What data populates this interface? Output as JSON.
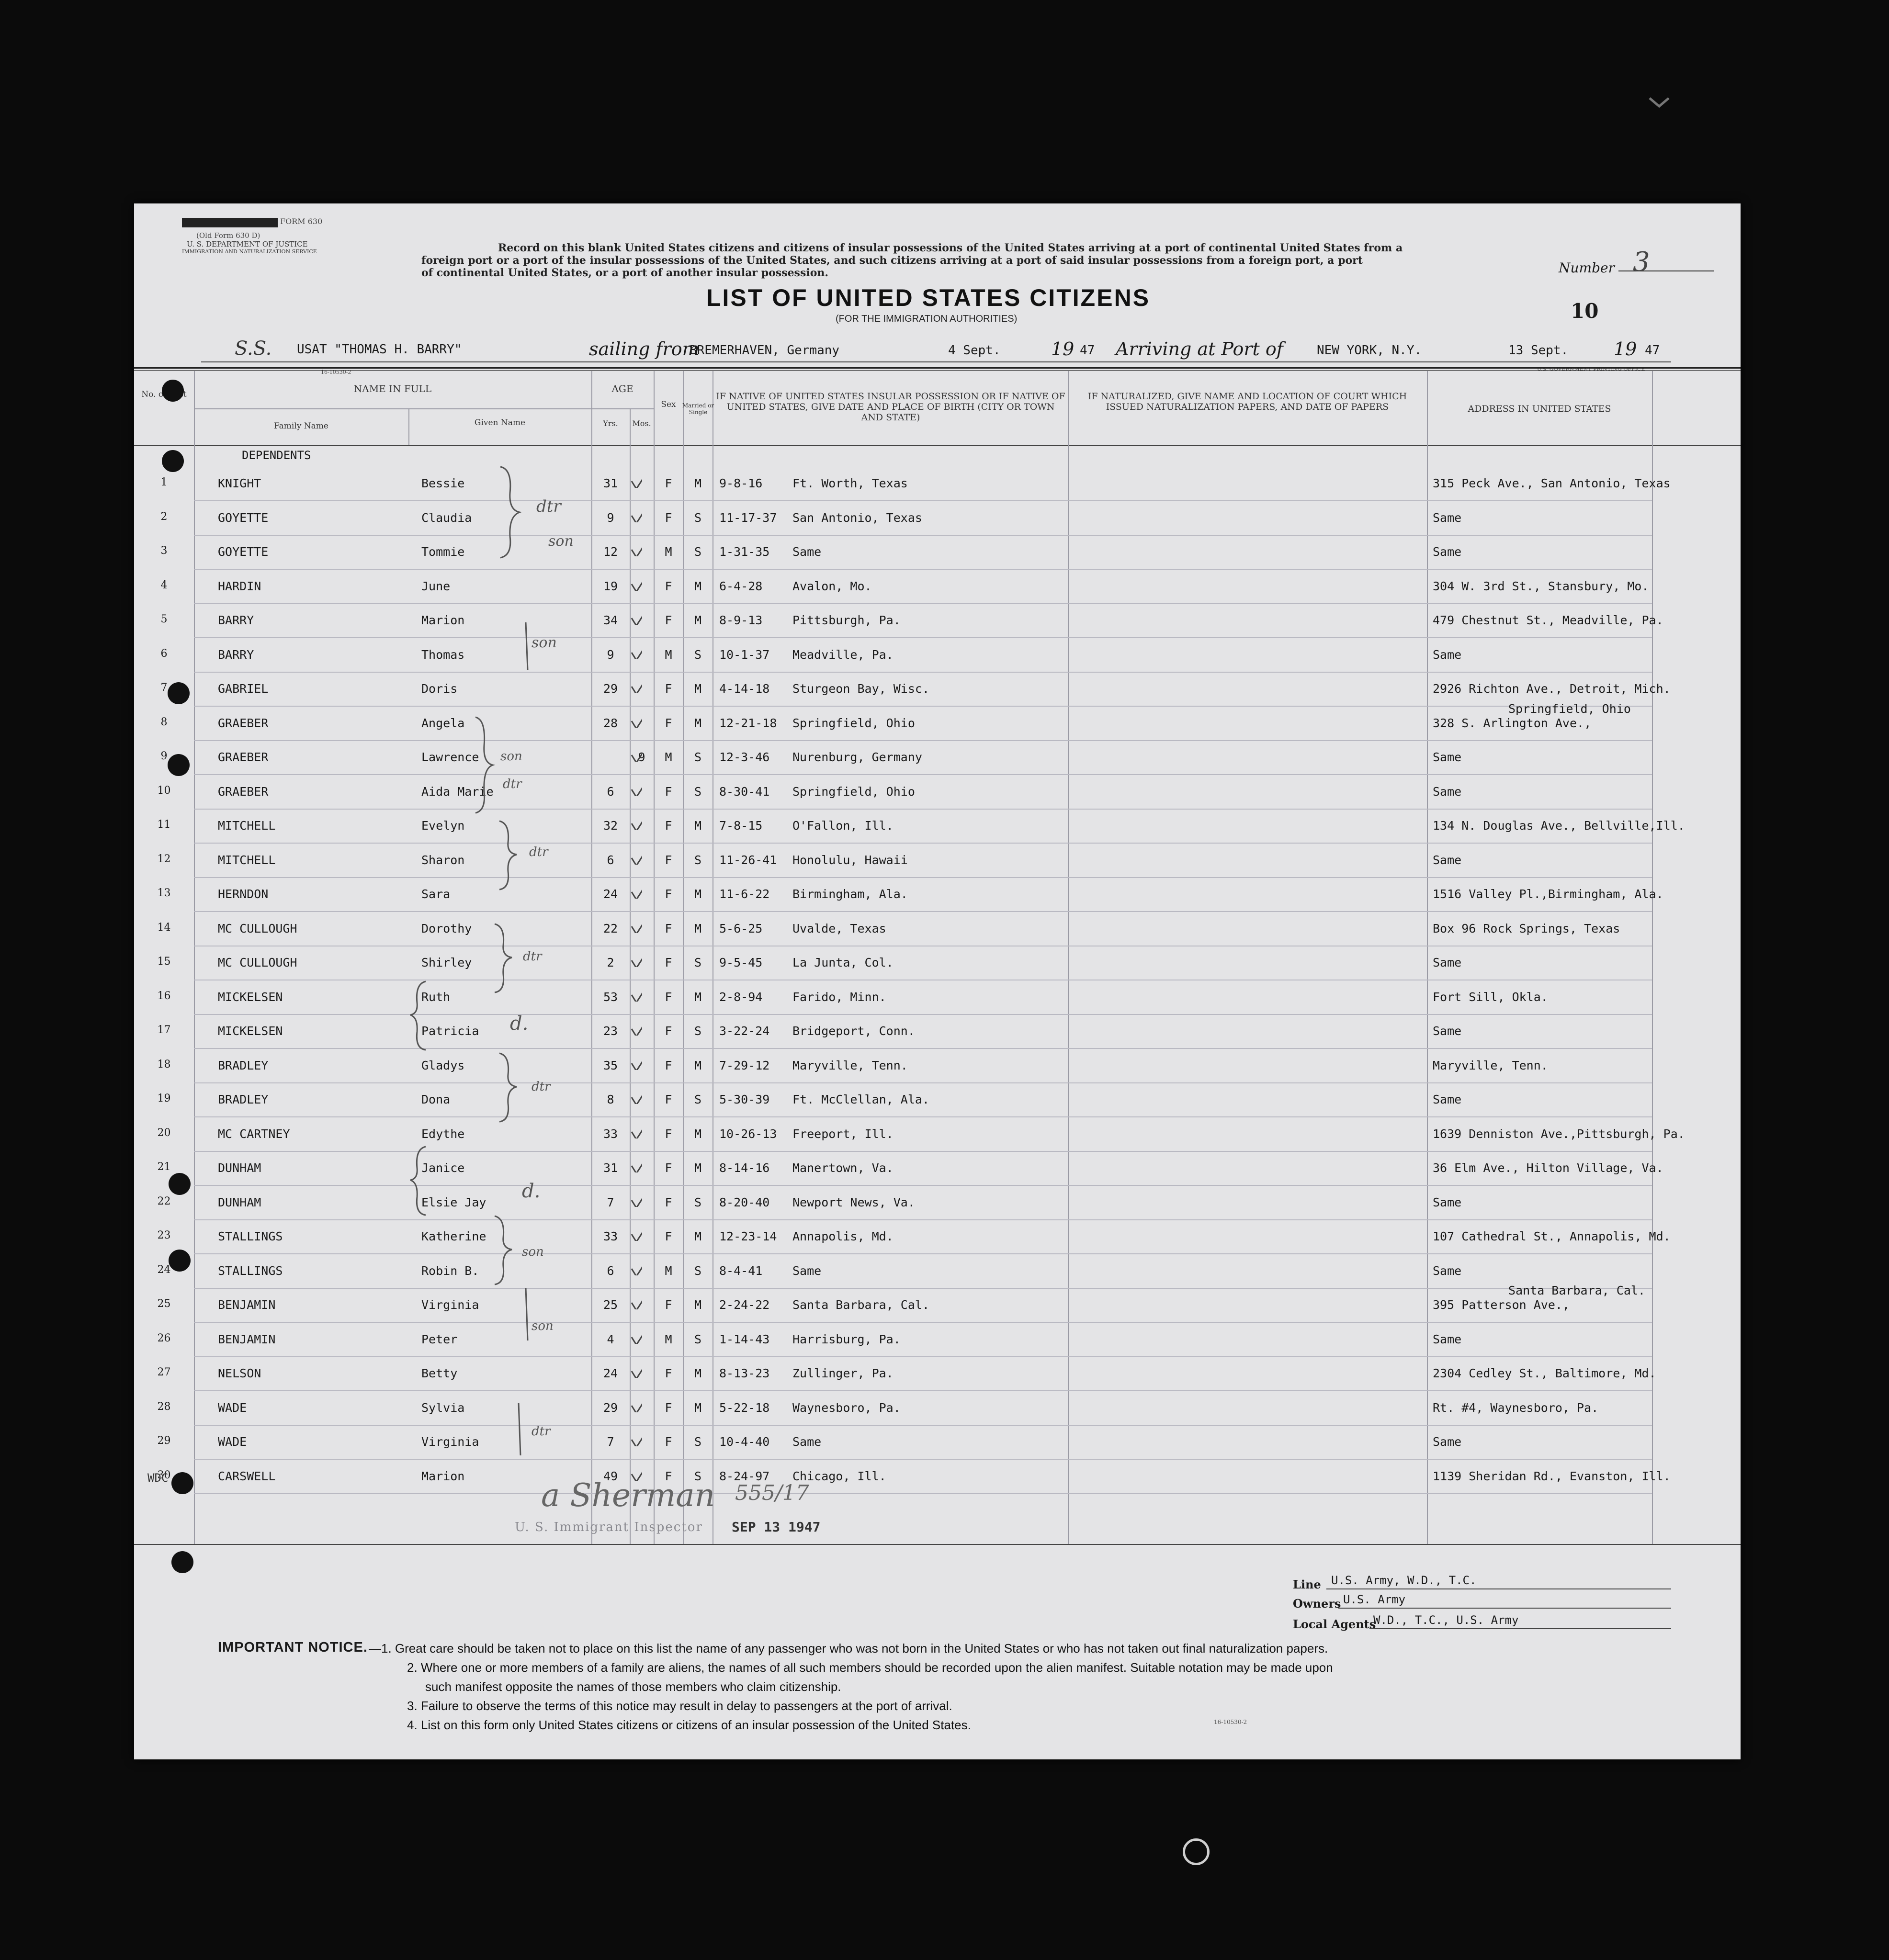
{
  "form": {
    "form_no_small": "FORM 630",
    "old_form": "(Old Form 630 D)",
    "department": "U. S. DEPARTMENT OF JUSTICE",
    "service": "IMMIGRATION AND NATURALIZATION SERVICE",
    "instruction_lines": [
      "Record on this blank United States citizens and citizens of insular possessions of the United States arriving at a port of continental United States from a",
      "foreign port or a port of the insular possessions of the United States, and such citizens arriving at a port of said insular possessions from a foreign port, a port",
      "of continental United States, or a port of another insular possession."
    ],
    "title": "LIST OF UNITED STATES CITIZENS",
    "subtitle": "(FOR THE IMMIGRATION AUTHORITIES)",
    "number_label": "Number",
    "number_value": "3",
    "page_number": "10",
    "form_code": "16-10530-2",
    "printer": "U.S. GOVERNMENT PRINTING OFFICE"
  },
  "voyage": {
    "prefix": "S.S.",
    "ship": "USAT \"THOMAS H. BARRY\"",
    "sailing_from_label": "sailing from",
    "sailing_from": "BREMERHAVEN, Germany",
    "depart_date": "4 Sept.",
    "year_prefix": "19",
    "depart_year": "47",
    "arriving_label": "Arriving at Port of",
    "arrival_port": "NEW YORK, N.Y.",
    "arrival_date": "13 Sept.",
    "arrival_year": "47"
  },
  "columns": {
    "no": "No. on List",
    "name_in_full": "NAME IN FULL",
    "family_name": "Family Name",
    "given_name": "Given Name",
    "age": "AGE",
    "yrs": "Yrs.",
    "mos": "Mos.",
    "sex": "Sex",
    "married": "Married or Single",
    "birth": "IF NATIVE OF UNITED STATES INSULAR POSSESSION OR IF NATIVE OF UNITED STATES, GIVE DATE AND PLACE OF BIRTH (CITY OR TOWN AND STATE)",
    "naturalized": "IF NATURALIZED, GIVE NAME AND LOCATION OF COURT WHICH ISSUED NATURALIZATION PAPERS, AND DATE OF PAPERS",
    "address": "ADDRESS IN UNITED STATES"
  },
  "section_label": "DEPENDENTS",
  "rows": [
    {
      "no": "1",
      "family": "KNIGHT",
      "given": "Bessie",
      "yrs": "31",
      "sex": "F",
      "ms": "M",
      "dob": "9-8-16",
      "place": "Ft. Worth, Texas",
      "address": "315 Peck Ave., San Antonio, Texas"
    },
    {
      "no": "2",
      "family": "GOYETTE",
      "given": "Claudia",
      "yrs": "9",
      "sex": "F",
      "ms": "S",
      "dob": "11-17-37",
      "place": "San Antonio, Texas",
      "address": "Same"
    },
    {
      "no": "3",
      "family": "GOYETTE",
      "given": "Tommie",
      "yrs": "12",
      "sex": "M",
      "ms": "S",
      "dob": "1-31-35",
      "place": "Same",
      "address": "Same"
    },
    {
      "no": "4",
      "family": "HARDIN",
      "given": "June",
      "yrs": "19",
      "sex": "F",
      "ms": "M",
      "dob": "6-4-28",
      "place": "Avalon, Mo.",
      "address": "304 W. 3rd St., Stansbury, Mo."
    },
    {
      "no": "5",
      "family": "BARRY",
      "given": "Marion",
      "yrs": "34",
      "sex": "F",
      "ms": "M",
      "dob": "8-9-13",
      "place": "Pittsburgh, Pa.",
      "address": "479 Chestnut St., Meadville, Pa."
    },
    {
      "no": "6",
      "family": "BARRY",
      "given": "Thomas",
      "yrs": "9",
      "sex": "M",
      "ms": "S",
      "dob": "10-1-37",
      "place": "Meadville, Pa.",
      "address": "Same"
    },
    {
      "no": "7",
      "family": "GABRIEL",
      "given": "Doris",
      "yrs": "29",
      "sex": "F",
      "ms": "M",
      "dob": "4-14-18",
      "place": "Sturgeon Bay, Wisc.",
      "address": "2926 Richton Ave., Detroit, Mich."
    },
    {
      "no": "8",
      "family": "GRAEBER",
      "given": "Angela",
      "yrs": "28",
      "sex": "F",
      "ms": "M",
      "dob": "12-21-18",
      "place": "Springfield, Ohio",
      "address": "328 S. Arlington Ave.,",
      "address_above": "Springfield, Ohio"
    },
    {
      "no": "9",
      "family": "GRAEBER",
      "given": "Lawrence",
      "yrs": "",
      "mos": "9",
      "sex": "M",
      "ms": "S",
      "dob": "12-3-46",
      "place": "Nurenburg, Germany",
      "address": "Same"
    },
    {
      "no": "10",
      "family": "GRAEBER",
      "given": "Aida Marie",
      "yrs": "6",
      "sex": "F",
      "ms": "S",
      "dob": "8-30-41",
      "place": "Springfield, Ohio",
      "address": "Same"
    },
    {
      "no": "11",
      "family": "MITCHELL",
      "given": "Evelyn",
      "yrs": "32",
      "sex": "F",
      "ms": "M",
      "dob": "7-8-15",
      "place": "O'Fallon, Ill.",
      "address": "134 N. Douglas Ave., Bellville,Ill."
    },
    {
      "no": "12",
      "family": "MITCHELL",
      "given": "Sharon",
      "yrs": "6",
      "sex": "F",
      "ms": "S",
      "dob": "11-26-41",
      "place": "Honolulu, Hawaii",
      "address": "Same"
    },
    {
      "no": "13",
      "family": "HERNDON",
      "given": "Sara",
      "yrs": "24",
      "sex": "F",
      "ms": "M",
      "dob": "11-6-22",
      "place": "Birmingham, Ala.",
      "address": "1516 Valley Pl.,Birmingham, Ala."
    },
    {
      "no": "14",
      "family": "MC CULLOUGH",
      "given": "Dorothy",
      "yrs": "22",
      "sex": "F",
      "ms": "M",
      "dob": "5-6-25",
      "place": "Uvalde, Texas",
      "address": "Box 96 Rock Springs, Texas"
    },
    {
      "no": "15",
      "family": "MC CULLOUGH",
      "given": "Shirley",
      "yrs": "2",
      "sex": "F",
      "ms": "S",
      "dob": "9-5-45",
      "place": "La Junta, Col.",
      "address": "Same"
    },
    {
      "no": "16",
      "family": "MICKELSEN",
      "given": "Ruth",
      "yrs": "53",
      "sex": "F",
      "ms": "M",
      "dob": "2-8-94",
      "place": "Farido, Minn.",
      "address": "Fort Sill, Okla."
    },
    {
      "no": "17",
      "family": "MICKELSEN",
      "given": "Patricia",
      "yrs": "23",
      "sex": "F",
      "ms": "S",
      "dob": "3-22-24",
      "place": "Bridgeport, Conn.",
      "address": "Same"
    },
    {
      "no": "18",
      "family": "BRADLEY",
      "given": "Gladys",
      "yrs": "35",
      "sex": "F",
      "ms": "M",
      "dob": "7-29-12",
      "place": "Maryville, Tenn.",
      "address": "Maryville, Tenn."
    },
    {
      "no": "19",
      "family": "BRADLEY",
      "given": "Dona",
      "yrs": "8",
      "sex": "F",
      "ms": "S",
      "dob": "5-30-39",
      "place": "Ft. McClellan, Ala.",
      "address": "Same"
    },
    {
      "no": "20",
      "family": "MC CARTNEY",
      "given": "Edythe",
      "yrs": "33",
      "sex": "F",
      "ms": "M",
      "dob": "10-26-13",
      "place": "Freeport, Ill.",
      "address": "1639 Denniston Ave.,Pittsburgh, Pa."
    },
    {
      "no": "21",
      "family": "DUNHAM",
      "given": "Janice",
      "yrs": "31",
      "sex": "F",
      "ms": "M",
      "dob": "8-14-16",
      "place": "Manertown, Va.",
      "address": "36 Elm Ave., Hilton Village, Va."
    },
    {
      "no": "22",
      "family": "DUNHAM",
      "given": "Elsie Jay",
      "yrs": "7",
      "sex": "F",
      "ms": "S",
      "dob": "8-20-40",
      "place": "Newport News, Va.",
      "address": "Same"
    },
    {
      "no": "23",
      "family": "STALLINGS",
      "given": "Katherine",
      "yrs": "33",
      "sex": "F",
      "ms": "M",
      "dob": "12-23-14",
      "place": "Annapolis, Md.",
      "address": "107 Cathedral St., Annapolis, Md."
    },
    {
      "no": "24",
      "family": "STALLINGS",
      "given": "Robin B.",
      "yrs": "6",
      "sex": "M",
      "ms": "S",
      "dob": "8-4-41",
      "place": "Same",
      "address": "Same"
    },
    {
      "no": "25",
      "family": "BENJAMIN",
      "given": "Virginia",
      "yrs": "25",
      "sex": "F",
      "ms": "M",
      "dob": "2-24-22",
      "place": "Santa Barbara, Cal.",
      "address": "395 Patterson Ave.,",
      "address_above": "Santa Barbara, Cal."
    },
    {
      "no": "26",
      "family": "BENJAMIN",
      "given": "Peter",
      "yrs": "4",
      "sex": "M",
      "ms": "S",
      "dob": "1-14-43",
      "place": "Harrisburg, Pa.",
      "address": "Same"
    },
    {
      "no": "27",
      "family": "NELSON",
      "given": "Betty",
      "yrs": "24",
      "sex": "F",
      "ms": "M",
      "dob": "8-13-23",
      "place": "Zullinger, Pa.",
      "address": "2304 Cedley St., Baltimore, Md."
    },
    {
      "no": "28",
      "family": "WADE",
      "given": "Sylvia",
      "yrs": "29",
      "sex": "F",
      "ms": "M",
      "dob": "5-22-18",
      "place": "Waynesboro, Pa.",
      "address": "Rt. #4, Waynesboro, Pa."
    },
    {
      "no": "29",
      "family": "WADE",
      "given": "Virginia",
      "yrs": "7",
      "sex": "F",
      "ms": "S",
      "dob": "10-4-40",
      "place": "Same",
      "address": "Same"
    },
    {
      "no": "30",
      "family": "CARSWELL",
      "given": "Marion",
      "yrs": "49",
      "sex": "F",
      "ms": "S",
      "dob": "8-24-97",
      "place": "Chicago, Ill.",
      "address": "1139 Sheridan Rd., Evanston, Ill."
    }
  ],
  "annotations": {
    "dtr": "dtr",
    "son": "son",
    "d": "d.",
    "wdc": "WDC"
  },
  "inspector": {
    "signature": "a Sherman",
    "code": "555/17",
    "label": "U. S. Immigrant Inspector",
    "date_stamp": "SEP 13 1947"
  },
  "footer": {
    "line_label": "Line",
    "line_value": "U.S. Army, W.D., T.C.",
    "owners_label": "Owners",
    "owners_value": "U.S. Army",
    "agents_label": "Local Agents",
    "agents_value": "W.D., T.C., U.S. Army"
  },
  "notice": {
    "heading": "IMPORTANT NOTICE.",
    "items": [
      "—1. Great care should be taken not to place on this list the name of any passenger who was not born in the United States or who has not taken out final naturalization papers.",
      "2. Where one or more members of a family are aliens, the names of all such members should be recorded upon the alien manifest.  Suitable notation may be made upon",
      "such manifest opposite the names of those members who claim citizenship.",
      "3. Failure to observe the terms of this notice may result in delay to passengers at the port of arrival.",
      "4. List on this form only United States citizens or citizens of an insular possession of the United States."
    ],
    "code": "16-10530-2"
  }
}
